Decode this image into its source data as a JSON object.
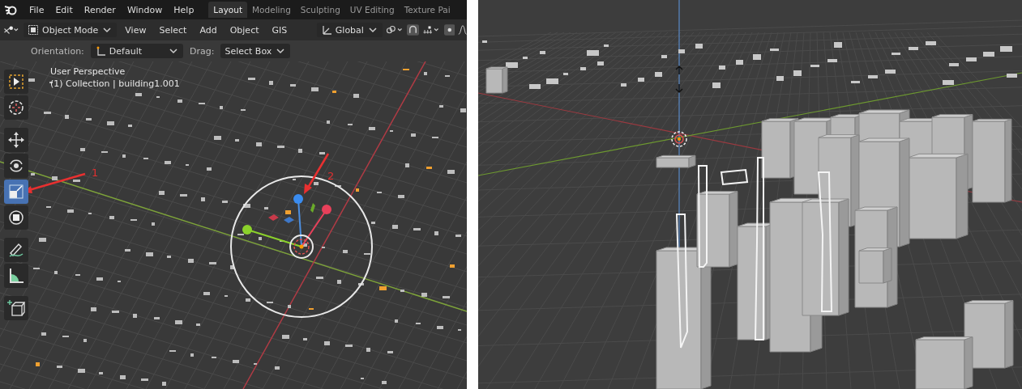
{
  "menu": [
    "File",
    "Edit",
    "Render",
    "Window",
    "Help"
  ],
  "workspaces": [
    {
      "label": "Layout",
      "selected": true
    },
    {
      "label": "Modeling",
      "selected": false
    },
    {
      "label": "Sculpting",
      "selected": false
    },
    {
      "label": "UV Editing",
      "selected": false
    },
    {
      "label": "Texture Pai",
      "selected": false
    }
  ],
  "header": {
    "mode": "Object Mode",
    "menus": [
      "View",
      "Select",
      "Add",
      "Object",
      "GIS"
    ],
    "transform": "Global"
  },
  "tool_settings": {
    "orientation_label": "Orientation:",
    "orientation": "Default",
    "drag_label": "Drag:",
    "drag": "Select Box"
  },
  "viewport": {
    "perspective": "User Perspective",
    "collection": "(1) Collection | building1.001"
  },
  "toolbar": [
    {
      "kind": "select",
      "selected": false,
      "separator_before": false
    },
    {
      "kind": "cursor",
      "selected": false,
      "separator_before": false
    },
    {
      "kind": "move",
      "selected": false,
      "separator_before": true
    },
    {
      "kind": "rotate",
      "selected": false,
      "separator_before": false
    },
    {
      "kind": "scale",
      "selected": true,
      "separator_before": false
    },
    {
      "kind": "transform",
      "selected": false,
      "separator_before": false
    },
    {
      "kind": "annotate",
      "selected": false,
      "separator_before": true
    },
    {
      "kind": "measure",
      "selected": false,
      "separator_before": false
    },
    {
      "kind": "add-cube",
      "selected": false,
      "separator_before": true
    }
  ],
  "callouts": [
    "1",
    "2"
  ]
}
